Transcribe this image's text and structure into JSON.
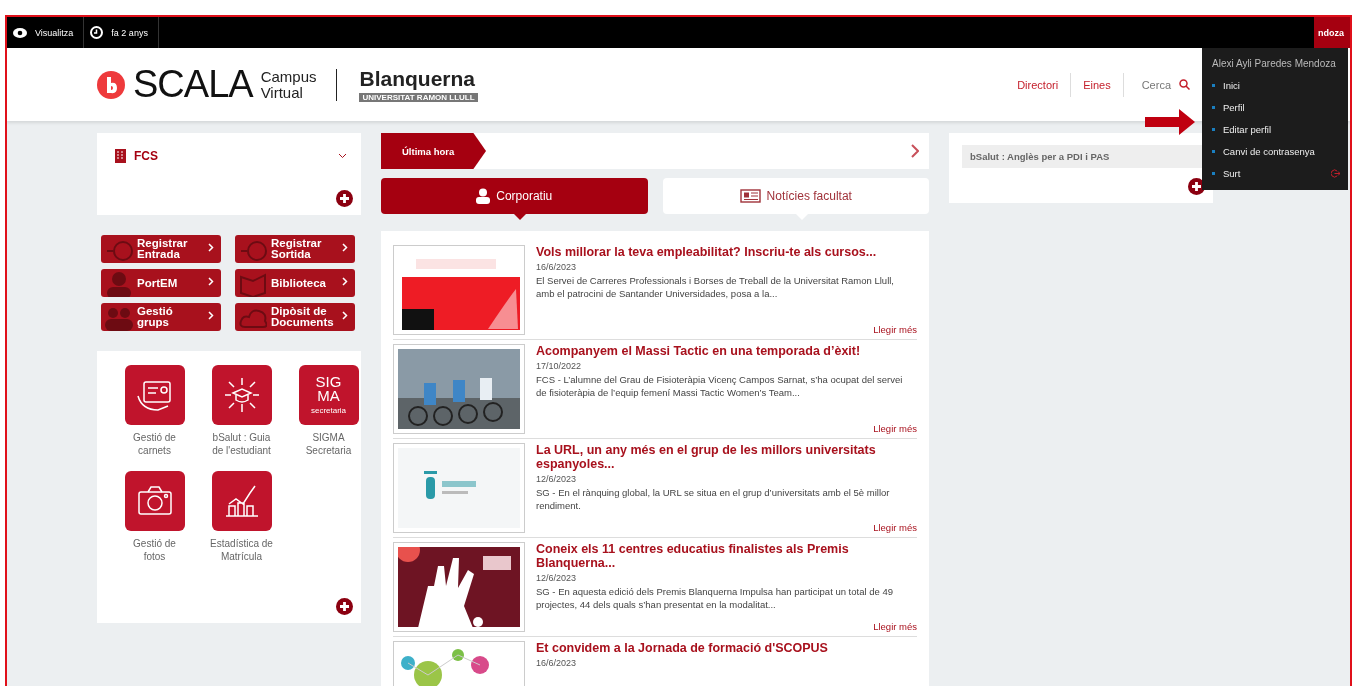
{
  "top_bar": {
    "items": [
      {
        "kind": "eye",
        "label": "Visualitza"
      },
      {
        "kind": "clock",
        "label": "fa 2 anys"
      }
    ],
    "user_fragment": "ndoza"
  },
  "header": {
    "logo": {
      "brand": "SCALA",
      "sub1": "Campus",
      "sub2": "Virtual",
      "org": "Blanquerna",
      "org_sub": "UNIVERSITAT RAMON LLULL"
    },
    "nav": [
      "Directori",
      "Eines"
    ],
    "search_label": "Cerca"
  },
  "user_menu": {
    "name": "Alexi Ayli Paredes Mendoza",
    "items": [
      {
        "label": "Inici",
        "kind": "link"
      },
      {
        "label": "Perfil",
        "kind": "link"
      },
      {
        "label": "Editar perfil",
        "kind": "link"
      },
      {
        "label": "Canvi de contrasenya",
        "kind": "link"
      },
      {
        "label": "Surt",
        "kind": "logout"
      }
    ]
  },
  "faculty_selector": {
    "value": "FCS"
  },
  "quick_links": [
    {
      "label": "Registrar\nEntrada",
      "kind": "clock-in"
    },
    {
      "label": "Registrar\nSortida",
      "kind": "clock-out"
    },
    {
      "label": "PortEM",
      "kind": "person"
    },
    {
      "label": "Biblioteca",
      "kind": "book"
    },
    {
      "label": "Gestió grups",
      "kind": "group"
    },
    {
      "label": "Dipòsit de\nDocuments",
      "kind": "cloud"
    }
  ],
  "apps": [
    {
      "label": "Gestió de\ncarnets",
      "kind": "card"
    },
    {
      "label": "bSalut : Guia\nde l'estudiant",
      "kind": "guide"
    },
    {
      "label": "SIGMA\nSecretaria",
      "kind": "text",
      "tile_lines": [
        "SIG",
        "MA"
      ],
      "tile_sub": "secretaria"
    },
    {
      "label": "Gestió de\nfotos",
      "kind": "camera"
    },
    {
      "label": "Estadística de\nMatrícula",
      "kind": "chart"
    }
  ],
  "ticker": {
    "label": "Última hora"
  },
  "news_tabs": [
    {
      "label": "Corporatiu",
      "kind": "person",
      "selected": true
    },
    {
      "label": "Notícies facultat",
      "kind": "newspaper",
      "selected": false
    }
  ],
  "news": [
    {
      "title": "Vols millorar la teva empleabilitat? Inscriu-te als cursos...",
      "date": "16/6/2023",
      "summary": "El Servei de Carreres Professionals i Borses de Treball de la Universitat Ramon Llull, amb el patrocini de Santander Universidades, posa a la...",
      "more": "Llegir més",
      "kind": "picture"
    },
    {
      "title": "Acompanyem el Massi Tactic en una temporada d’èxit!",
      "date": "17/10/2022",
      "summary": "FCS - L’alumne del Grau de Fisioteràpia Vicenç Campos Sarnat, s’ha ocupat del servei de fisioteràpia de l’equip femení Massi Tactic Women’s Team...",
      "more": "Llegir més",
      "kind": "picture"
    },
    {
      "title": "La URL, un any més en el grup de les millors universitats espanyoles...",
      "date": "12/6/2023",
      "summary": "SG - En el rànquing global, la URL se situa en el grup d’universitats amb el 5è millor rendiment.",
      "more": "Llegir més",
      "kind": "picture"
    },
    {
      "title": "Coneix els 11 centres educatius finalistes als Premis Blanquerna...",
      "date": "12/6/2023",
      "summary": "SG - En aquesta edició dels Premis Blanquerna Impulsa han participat un total de 49 projectes, 44 dels quals s’han presentat en la modalitat...",
      "more": "Llegir més",
      "kind": "picture"
    },
    {
      "title": "Et convidem a la Jornada de formació d'SCOPUS",
      "date": "16/6/2023",
      "kind": "picture"
    }
  ],
  "right_panel": {
    "items": [
      "bSalut : Anglès per a PDI i PAS"
    ]
  }
}
